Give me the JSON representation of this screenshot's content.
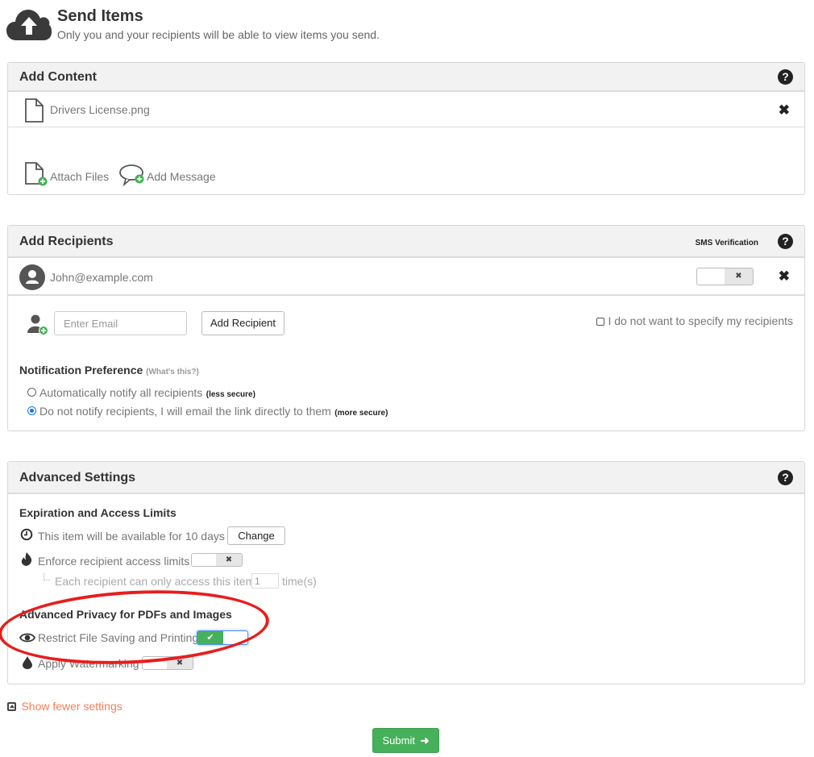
{
  "header": {
    "icon": "cloud-upload-icon",
    "title": "Send Items",
    "subtitle": "Only you and your recipients will be able to view items you send."
  },
  "add_content": {
    "title": "Add Content",
    "help_icon": "question-circle-icon",
    "files": [
      {
        "name": "Drivers License.png",
        "icon": "file-icon",
        "remove_icon": "close-icon"
      }
    ],
    "actions": [
      {
        "label": "Attach Files",
        "icon": "file-add-icon"
      },
      {
        "label": "Add Message",
        "icon": "comment-add-icon"
      }
    ]
  },
  "add_recipients": {
    "title": "Add Recipients",
    "sms_label": "SMS Verification",
    "help_icon": "question-circle-icon",
    "recipients": [
      {
        "email": "John@example.com",
        "sms_verification": false,
        "toggle_off_glyph": "✖"
      }
    ],
    "email_placeholder": "Enter Email",
    "add_button": "Add Recipient",
    "no_recipients_checkbox": {
      "label": "I do not want to specify my recipients",
      "checked": false
    },
    "notification": {
      "title": "Notification Preference",
      "whats_this": "(What's this?)",
      "options": [
        {
          "label": "Automatically notify all recipients",
          "note": "(less secure)",
          "selected": false
        },
        {
          "label": "Do not notify recipients, I will email the link directly to them",
          "note": "(more secure)",
          "selected": true
        }
      ]
    }
  },
  "advanced": {
    "title": "Advanced Settings",
    "help_icon": "question-circle-icon",
    "expiration": {
      "title": "Expiration and Access Limits",
      "availability_text": "This item will be available for 10 days",
      "change_button": "Change",
      "access_limits_label": "Enforce recipient access limits",
      "access_limits_enabled": false,
      "per_recipient_prefix": "Each recipient can only access this item",
      "per_recipient_value": "1",
      "per_recipient_suffix": "time(s)"
    },
    "privacy": {
      "title": "Advanced Privacy for PDFs and Images",
      "restrict_label": "Restrict File Saving and Printing",
      "restrict_enabled": true,
      "watermark_label": "Apply Watermarking",
      "watermark_enabled": false,
      "on_glyph": "✔",
      "off_glyph": "✖"
    }
  },
  "show_fewer": "Show fewer settings",
  "submit": "Submit",
  "colors": {
    "accent_green": "#47b05a",
    "link_orange": "#f0805a",
    "annotation_red": "#e81d1d",
    "radio_blue": "#1a73e8"
  }
}
